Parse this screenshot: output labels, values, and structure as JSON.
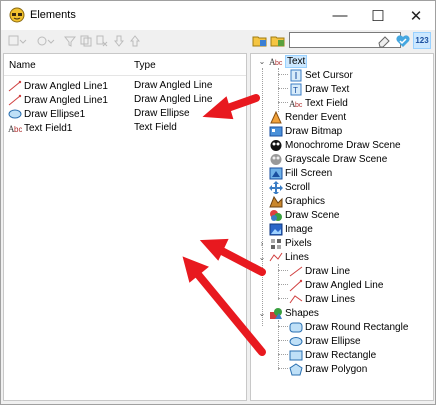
{
  "window": {
    "title": "Elements",
    "controls": {
      "minimize": "—",
      "maximize": "☐",
      "close": "✕"
    }
  },
  "toolbar": {
    "search_value": "",
    "numbers_label": "123"
  },
  "list": {
    "headers": {
      "name": "Name",
      "type": "Type"
    },
    "rows": [
      {
        "name": "Draw Angled Line1",
        "type": "Draw Angled Line",
        "icon": "angled-line-icon"
      },
      {
        "name": "Draw Angled Line1",
        "type": "Draw Angled Line",
        "icon": "angled-line-icon"
      },
      {
        "name": "Draw Ellipse1",
        "type": "Draw Ellipse",
        "icon": "ellipse-icon"
      },
      {
        "name": "Text Field1",
        "type": "Text Field",
        "icon": "text-field-icon"
      }
    ]
  },
  "tree": {
    "text": "Text",
    "set_cursor": "Set Cursor",
    "draw_text": "Draw Text",
    "text_field": "Text Field",
    "render_event": "Render Event",
    "draw_bitmap": "Draw Bitmap",
    "monochrome": "Monochrome Draw Scene",
    "grayscale": "Grayscale Draw Scene",
    "fill_screen": "Fill Screen",
    "scroll": "Scroll",
    "graphics": "Graphics",
    "draw_scene": "Draw Scene",
    "image": "Image",
    "pixels": "Pixels",
    "lines": "Lines",
    "draw_line": "Draw Line",
    "draw_angled_line": "Draw Angled Line",
    "draw_lines": "Draw Lines",
    "shapes": "Shapes",
    "draw_round_rect": "Draw Round Rectangle",
    "draw_ellipse": "Draw Ellipse",
    "draw_rectangle": "Draw Rectangle",
    "draw_polygon": "Draw Polygon"
  },
  "colors": {
    "accent_arrow": "#e8191f",
    "selection": "#cce8ff"
  }
}
